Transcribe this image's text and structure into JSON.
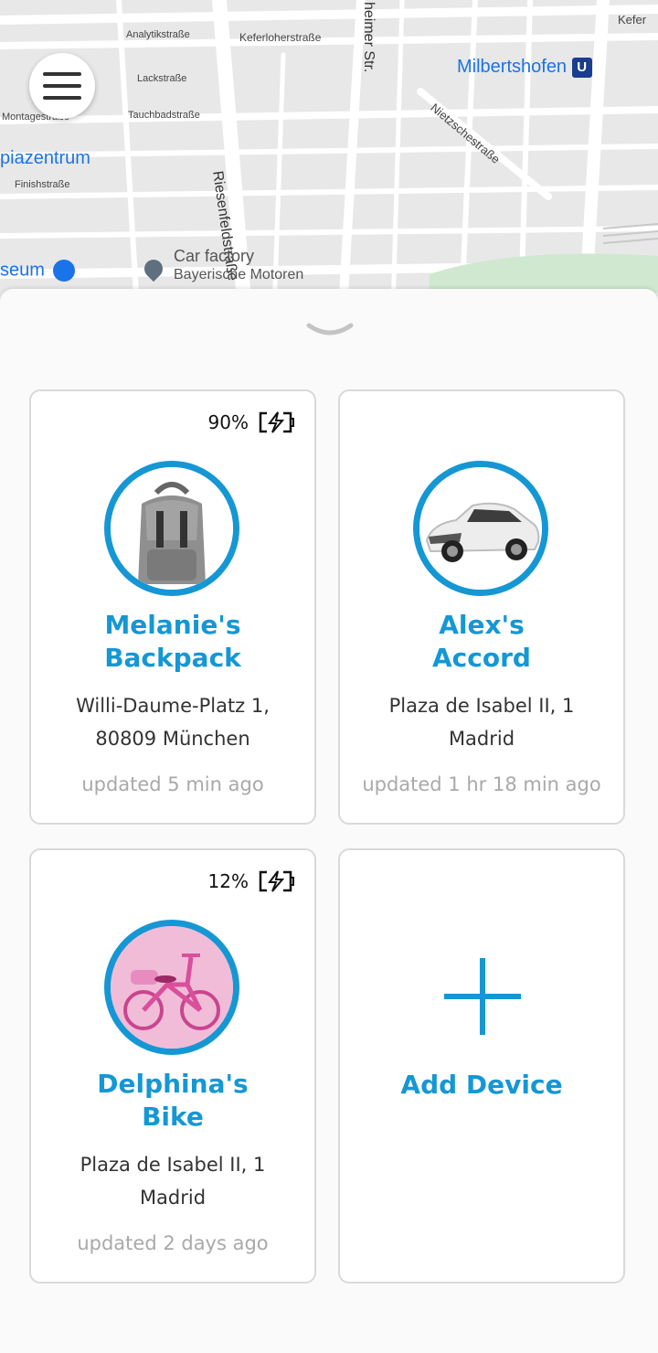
{
  "map": {
    "streets": [
      "Analytikstraße",
      "Keferloherstraße",
      "Lackstraße",
      "Montagestraße",
      "Tauchbadstraße",
      "Finishstraße",
      "Riesenfeldstraße",
      "heimer Str.",
      "Nietzschestraße",
      "Kefer"
    ],
    "places": {
      "station": "Milbertshofen",
      "station_badge": "U",
      "olympia": "piazentrum",
      "museum": "seum",
      "car_factory_title": "Car factory",
      "car_factory_sub": "Bayerische Motoren"
    }
  },
  "menu_icon": "hamburger-menu-icon",
  "devices": [
    {
      "name_line1": "Melanie's",
      "name_line2": "Backpack",
      "addr_line1": "Willi-Daume-Platz 1,",
      "addr_line2": "80809 München",
      "updated": "updated 5 min ago",
      "battery": "90%",
      "battery_icon": "battery-charging-icon",
      "image": "backpack"
    },
    {
      "name_line1": "Alex's",
      "name_line2": "Accord",
      "addr_line1": "Plaza de Isabel II, 1",
      "addr_line2": "Madrid",
      "updated": "updated 1 hr 18 min ago",
      "image": "car"
    },
    {
      "name_line1": "Delphina's",
      "name_line2": "Bike",
      "addr_line1": "Plaza de Isabel II, 1",
      "addr_line2": "Madrid",
      "updated": "updated 2 days ago",
      "battery": "12%",
      "battery_icon": "battery-charging-icon",
      "image": "bike"
    }
  ],
  "add_device": {
    "label": "Add Device",
    "icon": "plus-icon"
  },
  "colors": {
    "accent": "#1597d4",
    "map_bg": "#e8e8e8",
    "card_border": "#d9d9d9"
  }
}
